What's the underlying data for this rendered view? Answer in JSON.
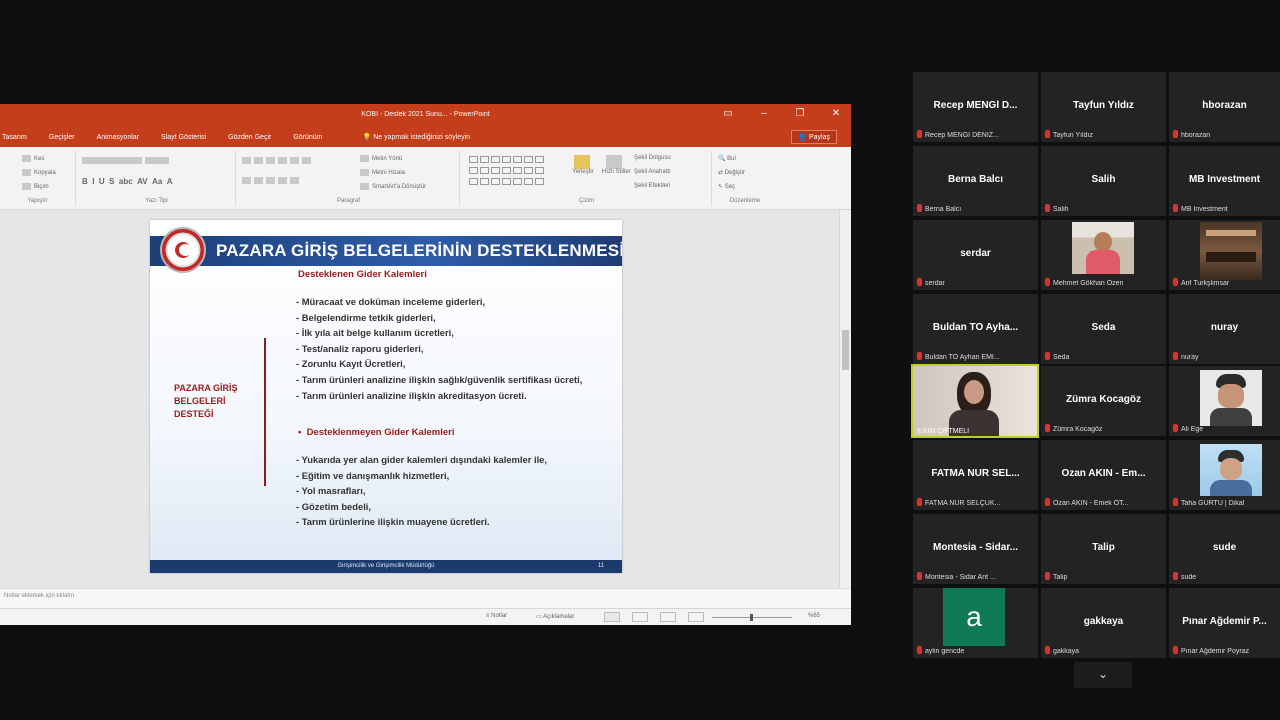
{
  "ppt": {
    "window_title": "KOBI - Destek 2021 Sunu... - PowerPoint",
    "menu_tabs": [
      "Tasarım",
      "Geçişler",
      "Animasyonlar",
      "Slayt Gösterisi",
      "Gözden Geçir",
      "Görünüm"
    ],
    "tell_me": "Ne yapmak istediğinizi söyleyin",
    "share_label": "Paylaş",
    "ribbon": {
      "clipboard_items": [
        "Kes",
        "Kopyala",
        "Biçim"
      ],
      "clipboard_label": "Yapıştır",
      "font_label": "Yazı Tipi",
      "paragraph_label": "Paragraf",
      "paragraph_items": [
        "Metin Yönü",
        "Metni Hizala",
        "SmartArt'a Dönüştür"
      ],
      "drawing_label": "Çizim",
      "arrange_label": "Yerleştir",
      "styles_label": "Hızlı Stiller",
      "shape_items": [
        "Şekil Dolgusu",
        "Şekil Anahattı",
        "Şekil Efektleri"
      ],
      "editing_items": [
        "Bul",
        "Değiştir",
        "Seç"
      ],
      "editing_label": "Düzenleme"
    },
    "slide": {
      "title": "PAZARA GİRİŞ BELGELERİNİN DESTEKLENMESİ",
      "left_label": [
        "PAZARA GİRİŞ",
        "BELGELERİ",
        "DESTEĞİ"
      ],
      "supported_heading": "Desteklenen Gider Kalemleri",
      "supported_items": [
        "- Müracaat ve doküman inceleme giderleri,",
        "- Belgelendirme tetkik giderleri,",
        "- İlk yıla ait belge kullanım ücretleri,",
        "- Test/analiz raporu giderleri,",
        "- Zorunlu Kayıt Ücretleri,",
        "- Tarım ürünleri analizine ilişkin sağlık/güvenlik sertifikası ücreti,",
        "- Tarım ürünleri analizine ilişkin akreditasyon ücreti."
      ],
      "unsupported_heading": "Desteklenmeyen Gider Kalemleri",
      "unsupported_items": [
        "- Yukarıda yer alan gider kalemleri dışındaki kalemler ile,",
        "- Eğitim ve danışmanlık hizmetleri,",
        "- Yol masrafları,",
        "- Gözetim bedeli,",
        "- Tarım ürünlerine ilişkin muayene ücretleri."
      ],
      "footer_text": "Girişimcilik ve Girişimcilik Müdürlüğü",
      "page_number": "11"
    },
    "notes_placeholder": "Notlar eklemek için tıklatın",
    "status": {
      "notes_btn": "Notlar",
      "comments_btn": "Açıklamalar",
      "zoom": "%65"
    }
  },
  "participants": [
    {
      "display": "Recep MENGİ D...",
      "label": "Recep MENGİ DENİZ..."
    },
    {
      "display": "Tayfun Yıldız",
      "label": "Tayfun Yıldız"
    },
    {
      "display": "hborazan",
      "label": "hborazan"
    },
    {
      "display": "Berna Balcı",
      "label": "Berna Balcı"
    },
    {
      "display": "Salih",
      "label": "Salih"
    },
    {
      "display": "MB Investment",
      "label": "MB Investment"
    },
    {
      "display": "serdar",
      "label": "serdar"
    },
    {
      "display": "",
      "label": "Mehmet Gökhan Özen"
    },
    {
      "display": "",
      "label": "Arif Turkşlimsar"
    },
    {
      "display": "Buldan TO Ayha...",
      "label": "Buldan TO Ayhan EMİ..."
    },
    {
      "display": "Seda",
      "label": "Seda"
    },
    {
      "display": "nuray",
      "label": "nuray"
    },
    {
      "display": "",
      "label": "İLKİM ÇİFTMELİ"
    },
    {
      "display": "Zümra Kocagöz",
      "label": "Zümra Kocagöz"
    },
    {
      "display": "",
      "label": "Ali Ege"
    },
    {
      "display": "FATMA NUR SEL...",
      "label": "FATMA NUR SELÇUK..."
    },
    {
      "display": "Ozan AKIN - Em...",
      "label": "Ozan AKIN - Emek OT..."
    },
    {
      "display": "",
      "label": "Taha GÜRTÜ | Dikal"
    },
    {
      "display": "Montesia - Sidar...",
      "label": "Montesia - Sidar Ant ..."
    },
    {
      "display": "Talip",
      "label": "Talip"
    },
    {
      "display": "sude",
      "label": "sude"
    },
    {
      "display": "a",
      "label": "aylin gencde"
    },
    {
      "display": "gakkaya",
      "label": "gakkaya"
    },
    {
      "display": "Pınar Ağdemir P...",
      "label": "Pınar Ağdemir Poyraz"
    }
  ],
  "colors": {
    "ppt_red": "#c43e1c",
    "slide_banner": "#2f5da8",
    "slide_heading": "#9b1b1b",
    "active_speaker": "#b9d21e",
    "mic_muted": "#e03131",
    "avatar_green": "#0f7a53"
  },
  "icons": {
    "minimize": "minimize-icon",
    "restore": "restore-icon",
    "close": "close-icon",
    "mic_muted": "mic-muted-icon",
    "chevron": "chevron-down-icon"
  }
}
